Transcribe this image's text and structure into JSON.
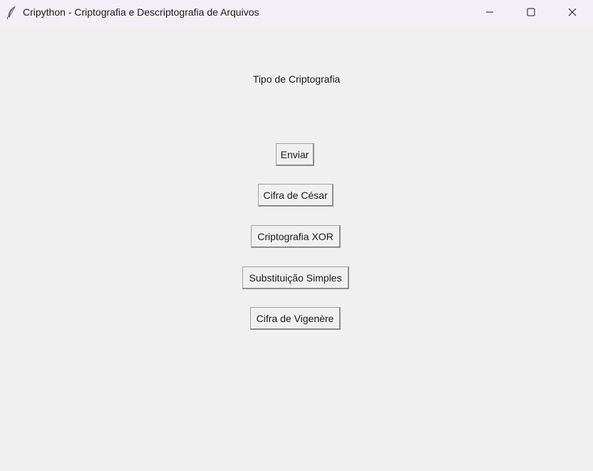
{
  "window": {
    "title": "Cripython - Criptografia e Descriptografia de Arquivos",
    "icon": "feather-icon",
    "controls": {
      "minimize": "minimize-icon",
      "maximize": "maximize-icon",
      "close": "close-icon"
    }
  },
  "main": {
    "heading": "Tipo de Criptografia",
    "buttons": {
      "send": "Enviar",
      "caesar": "Cifra de César",
      "xor": "Criptografia XOR",
      "substitution": "Substituição Simples",
      "vigenere": "Cifra de Vigenère"
    }
  },
  "colors": {
    "background": "#f0f0f0",
    "titlebar": "#f3eff7",
    "text": "#1a1a1a"
  }
}
